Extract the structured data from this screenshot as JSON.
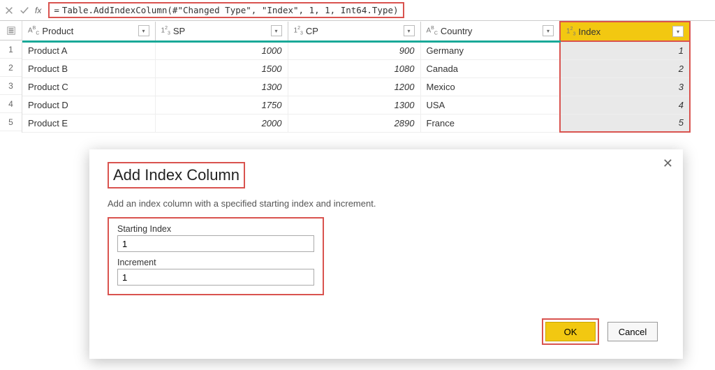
{
  "formula_bar": {
    "equals": "=",
    "formula_display": "Table.AddIndexColumn(#\"Changed Type\", \"Index\", 1, 1, Int64.Type)"
  },
  "columns": [
    {
      "name": "Product",
      "type_label": "ABC"
    },
    {
      "name": "SP",
      "type_label": "123"
    },
    {
      "name": "CP",
      "type_label": "123"
    },
    {
      "name": "Country",
      "type_label": "ABC"
    },
    {
      "name": "Index",
      "type_label": "123",
      "highlighted": true
    }
  ],
  "rows": [
    {
      "n": "1",
      "product": "Product A",
      "sp": "1000",
      "cp": "900",
      "country": "Germany",
      "index": "1"
    },
    {
      "n": "2",
      "product": "Product B",
      "sp": "1500",
      "cp": "1080",
      "country": "Canada",
      "index": "2"
    },
    {
      "n": "3",
      "product": "Product C",
      "sp": "1300",
      "cp": "1200",
      "country": "Mexico",
      "index": "3"
    },
    {
      "n": "4",
      "product": "Product D",
      "sp": "1750",
      "cp": "1300",
      "country": "USA",
      "index": "4"
    },
    {
      "n": "5",
      "product": "Product E",
      "sp": "2000",
      "cp": "2890",
      "country": "France",
      "index": "5"
    }
  ],
  "dialog": {
    "title": "Add Index Column",
    "description": "Add an index column with a specified starting index and increment.",
    "fields": {
      "starting_label": "Starting Index",
      "starting_value": "1",
      "increment_label": "Increment",
      "increment_value": "1"
    },
    "buttons": {
      "ok": "OK",
      "cancel": "Cancel"
    }
  },
  "type_icons": {
    "abc_small": "A",
    "abc_sup": "B",
    "abc_c": "C",
    "num_1": "1",
    "num_2": "2",
    "num_3": "3"
  }
}
